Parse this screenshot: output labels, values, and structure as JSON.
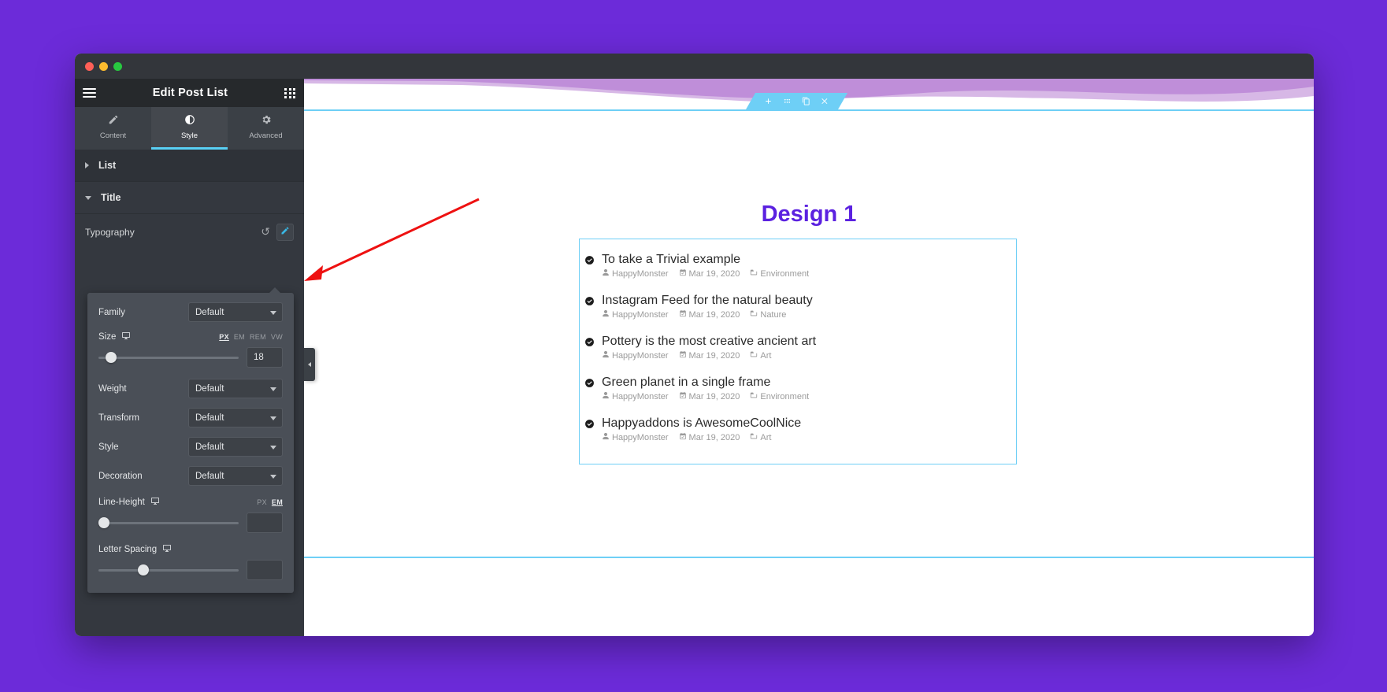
{
  "window": {
    "traffic_lights": [
      "close",
      "minimize",
      "maximize"
    ]
  },
  "panel": {
    "title": "Edit Post List",
    "menu_icon": "hamburger-icon",
    "apps_icon": "grid-icon",
    "tabs": [
      {
        "label": "Content",
        "icon": "pencil-icon",
        "active": false
      },
      {
        "label": "Style",
        "icon": "contrast-icon",
        "active": true
      },
      {
        "label": "Advanced",
        "icon": "gear-icon",
        "active": false
      }
    ],
    "sections": [
      {
        "label": "List",
        "expanded": false
      },
      {
        "label": "Title",
        "expanded": true
      }
    ],
    "typography": {
      "label": "Typography",
      "reset_icon": "reset-icon",
      "edit_icon": "pencil-icon",
      "controls": {
        "family": {
          "label": "Family",
          "value": "Default"
        },
        "size": {
          "label": "Size",
          "value": "18",
          "units": [
            "PX",
            "EM",
            "REM",
            "VW"
          ],
          "active_unit": "PX",
          "slider_percent": 10,
          "responsive_icon": "monitor-icon"
        },
        "weight": {
          "label": "Weight",
          "value": "Default"
        },
        "transform": {
          "label": "Transform",
          "value": "Default"
        },
        "style": {
          "label": "Style",
          "value": "Default"
        },
        "decoration": {
          "label": "Decoration",
          "value": "Default"
        },
        "line_height": {
          "label": "Line-Height",
          "value": "",
          "units": [
            "PX",
            "EM"
          ],
          "active_unit": "EM",
          "slider_percent": 1,
          "responsive_icon": "monitor-icon"
        },
        "letter_spacing": {
          "label": "Letter Spacing",
          "value": "",
          "slider_percent": 30,
          "responsive_icon": "monitor-icon"
        }
      }
    },
    "collapse_handle_icon": "chevron-left-icon"
  },
  "canvas": {
    "widget_toolbar": [
      {
        "icon": "plus-icon",
        "name": "add-widget"
      },
      {
        "icon": "drag-dots-icon",
        "name": "drag-widget"
      },
      {
        "icon": "duplicate-icon",
        "name": "duplicate-widget"
      },
      {
        "icon": "close-icon",
        "name": "delete-widget"
      }
    ],
    "design_title": "Design 1",
    "accent_color": "#5b21e0",
    "highlight_color": "#6ecff6",
    "posts": [
      {
        "title": "To take a Trivial example",
        "author": "HappyMonster",
        "date": "Mar 19, 2020",
        "category": "Environment"
      },
      {
        "title": "Instagram Feed for the natural beauty",
        "author": "HappyMonster",
        "date": "Mar 19, 2020",
        "category": "Nature"
      },
      {
        "title": "Pottery is the most creative ancient art",
        "author": "HappyMonster",
        "date": "Mar 19, 2020",
        "category": "Art"
      },
      {
        "title": "Green planet in a single frame",
        "author": "HappyMonster",
        "date": "Mar 19, 2020",
        "category": "Environment"
      },
      {
        "title": "Happyaddons is AwesomeCoolNice",
        "author": "HappyMonster",
        "date": "Mar 19, 2020",
        "category": "Art"
      }
    ],
    "annotation_arrow": {
      "color": "#ee1111",
      "points_to": "typography-edit-button"
    }
  }
}
